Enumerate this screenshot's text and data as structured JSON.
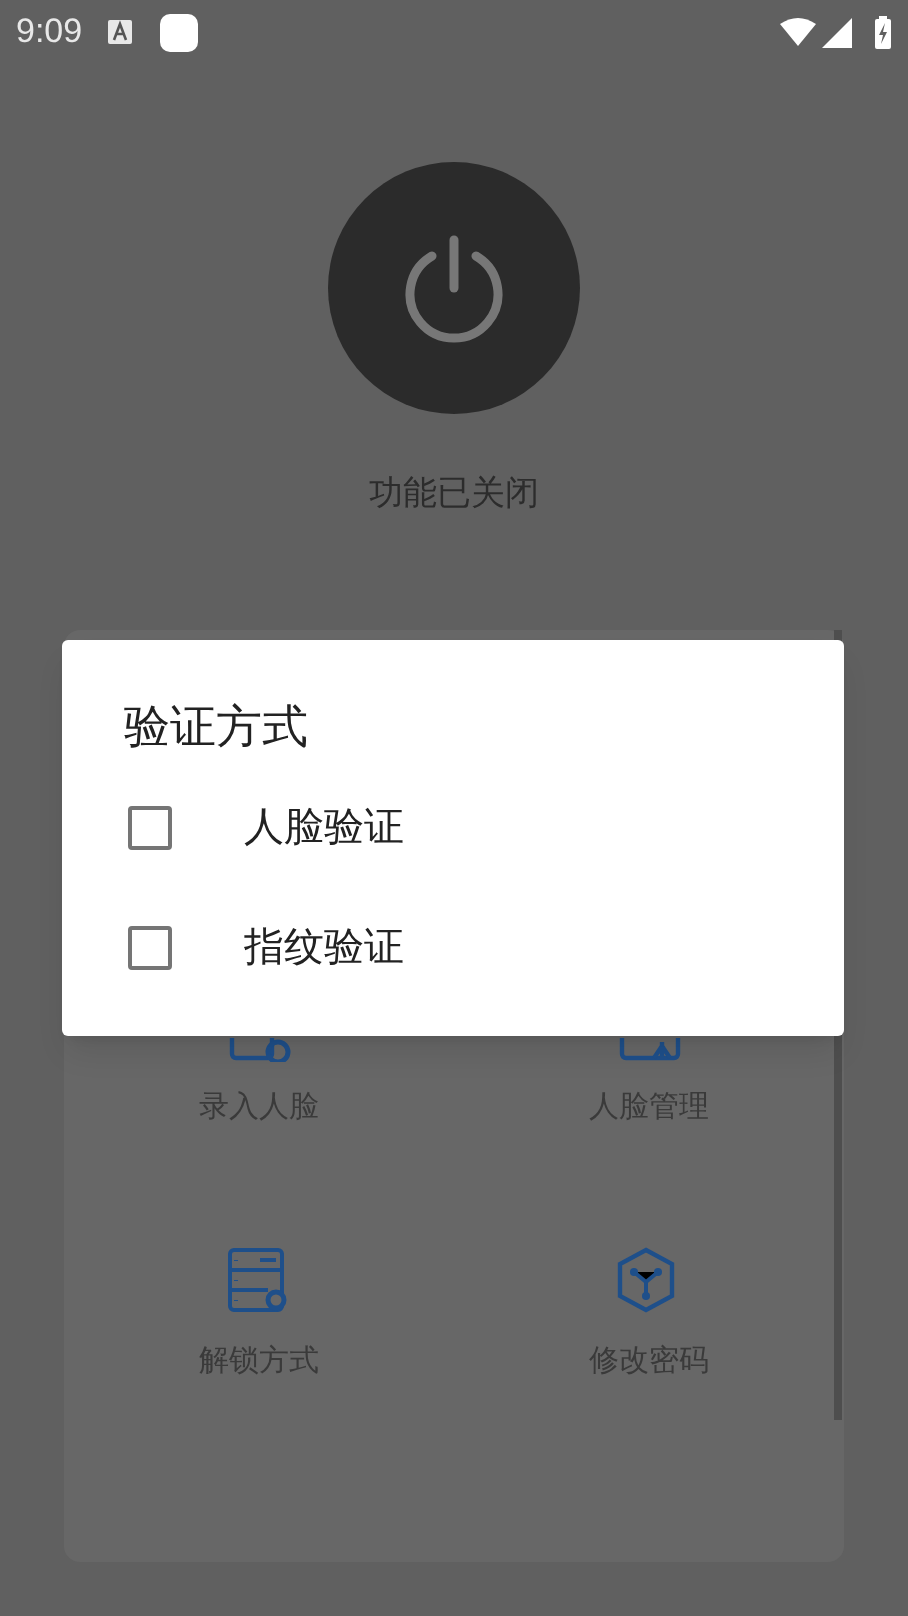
{
  "status_bar": {
    "time": "9:09"
  },
  "power": {
    "label": "功能已关闭",
    "on": false
  },
  "menu": [
    {
      "label": "录入人脸",
      "kind": "face-add"
    },
    {
      "label": "人脸管理",
      "kind": "face-manage"
    },
    {
      "label": "解锁方式",
      "kind": "unlock"
    },
    {
      "label": "修改密码",
      "kind": "password"
    }
  ],
  "dialog": {
    "title": "验证方式",
    "options": [
      {
        "label": "人脸验证",
        "checked": false
      },
      {
        "label": "指纹验证",
        "checked": false
      }
    ]
  }
}
